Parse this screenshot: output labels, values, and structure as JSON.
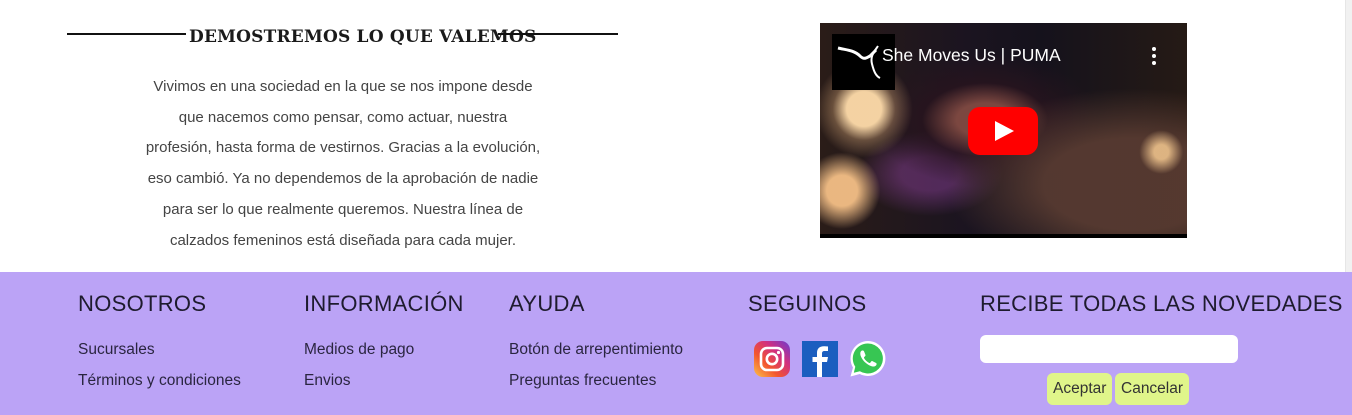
{
  "section": {
    "heading": "DEMOSTREMOS LO QUE VALEMOS",
    "paragraph": "Vivimos en una sociedad en la que se nos impone desde que nacemos como pensar, como actuar, nuestra profesión, hasta forma de vestirnos. Gracias a la evolución, eso cambió. Ya no dependemos de la aprobación de nadie para ser lo que realmente queremos. Nuestra línea de calzados femeninos está diseñada para cada mujer."
  },
  "video": {
    "title": "She Moves Us | PUMA",
    "icons": [
      "puma-logo-icon",
      "more-options-icon",
      "play-icon"
    ]
  },
  "footer": {
    "nosotros": {
      "title": "NOSOTROS",
      "links": [
        "Sucursales",
        "Términos y condiciones"
      ]
    },
    "informacion": {
      "title": "INFORMACIÓN",
      "links": [
        "Medios de pago",
        "Envios"
      ]
    },
    "ayuda": {
      "title": "AYUDA",
      "links": [
        "Botón de arrepentimiento",
        "Preguntas frecuentes"
      ]
    },
    "seguinos": {
      "title": "SEGUINOS",
      "icons": [
        "instagram-icon",
        "facebook-icon",
        "whatsapp-icon"
      ]
    },
    "newsletter": {
      "title": "RECIBE TODAS LAS NOVEDADES",
      "email_value": "",
      "accept_label": "Aceptar",
      "cancel_label": "Cancelar"
    }
  },
  "colors": {
    "footer_bg": "#bba3f6",
    "button_bg": "#e0f58a",
    "youtube_red": "#ff0000"
  }
}
